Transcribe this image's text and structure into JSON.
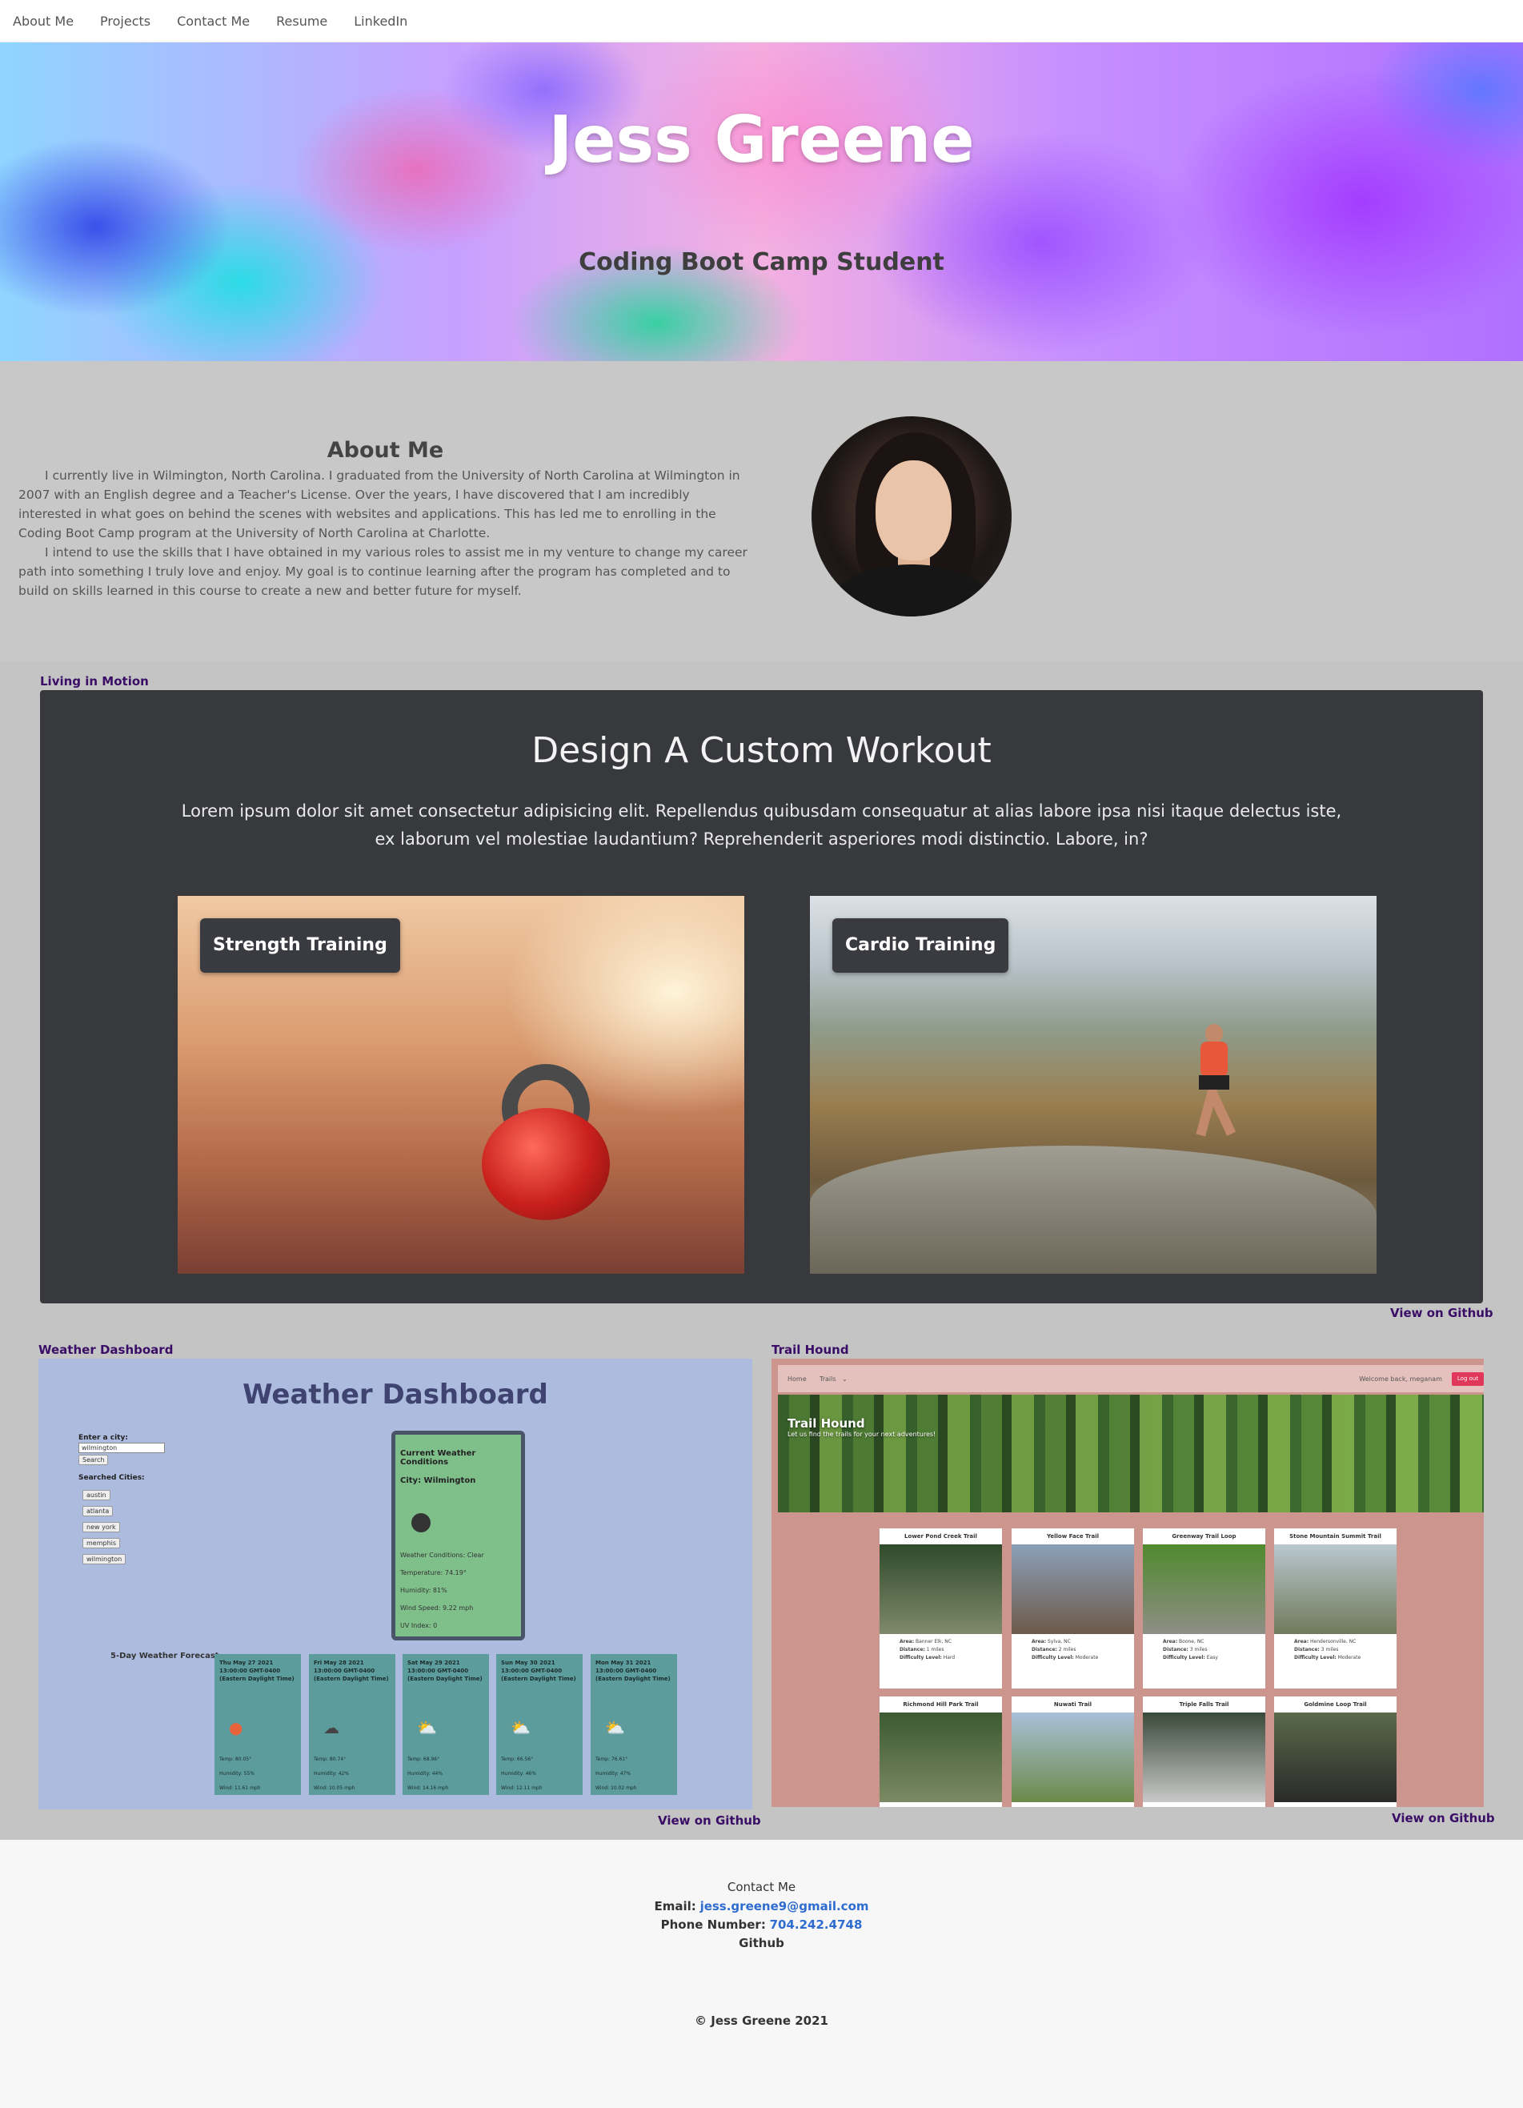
{
  "nav": {
    "items": [
      "About Me",
      "Projects",
      "Contact Me",
      "Resume",
      "LinkedIn"
    ]
  },
  "hero": {
    "title": "Jess Greene",
    "subtitle": "Coding Boot Camp Student"
  },
  "about": {
    "heading": "About Me",
    "paragraphs": [
      "I currently live in Wilmington, North Carolina. I graduated from the University of North Carolina at Wilmington in 2007 with an English degree and a Teacher's License. Over the years, I have discovered that I am incredibly interested in what goes on behind the scenes with websites and applications. This has led me to enrolling in the Coding Boot Camp program at the University of North Carolina at Charlotte.",
      "I intend to use the skills that I have obtained in my various roles to assist me in my venture to change my career path into something I truly love and enjoy. My goal is to continue learning after the program has completed and to build on skills learned in this course to create a new and better future for myself."
    ]
  },
  "projects": {
    "workout": {
      "label": "Living in Motion",
      "title": "Design A Custom Workout",
      "description": "Lorem ipsum dolor sit amet consectetur adipisicing elit. Repellendus quibusdam consequatur at alias labore ipsa nisi itaque delectus iste, ex laborum vel molestiae laudantium? Reprehenderit asperiores modi distinctio. Labore, in?",
      "cards": [
        "Strength Training",
        "Cardio Training"
      ],
      "github": "View on Github"
    },
    "weather": {
      "label": "Weather Dashboard",
      "title": "Weather Dashboard",
      "enter_city": "Enter a city:",
      "input_value": "wilmington",
      "search_button": "Search",
      "searched_label": "Searched Cities:",
      "cities": [
        "austin",
        "atlanta",
        "new york",
        "memphis",
        "wilmington"
      ],
      "current_title": "Current Weather Conditions",
      "current_city": "City: Wilmington",
      "current_values": [
        "Weather Conditions: Clear",
        "Temperature: 74.19°",
        "Humidity: 81%",
        "Wind Speed: 9.22 mph",
        "UV Index: 0"
      ],
      "forecast_label": "5-Day Weather Forecast",
      "forecast": [
        {
          "date": "Thu May 27 2021 13:00:00 GMT-0400 (Eastern Daylight Time)",
          "icon": "sun-icon",
          "glyph": "●",
          "color": "#e8633a",
          "temp": "Temp: 80.05°",
          "humidity": "Humidity: 55%",
          "wind": "Wind: 11.61 mph"
        },
        {
          "date": "Fri May 28 2021 13:00:00 GMT-0400 (Eastern Daylight Time)",
          "icon": "cloud-icon",
          "glyph": "☁",
          "color": "#444444",
          "temp": "Temp: 80.74°",
          "humidity": "Humidity: 42%",
          "wind": "Wind: 10.05 mph"
        },
        {
          "date": "Sat May 29 2021 13:00:00 GMT-0400 (Eastern Daylight Time)",
          "icon": "partly-cloudy-icon",
          "glyph": "⛅",
          "color": "#f0f0f0",
          "temp": "Temp: 68.96°",
          "humidity": "Humidity: 44%",
          "wind": "Wind: 14.16 mph"
        },
        {
          "date": "Sun May 30 2021 13:00:00 GMT-0400 (Eastern Daylight Time)",
          "icon": "partly-cloudy-icon",
          "glyph": "⛅",
          "color": "#f0f0f0",
          "temp": "Temp: 66.56°",
          "humidity": "Humidity: 46%",
          "wind": "Wind: 12.11 mph"
        },
        {
          "date": "Mon May 31 2021 13:00:00 GMT-0400 (Eastern Daylight Time)",
          "icon": "partly-cloudy-icon",
          "glyph": "⛅",
          "color": "#f0f0f0",
          "temp": "Temp: 76.61°",
          "humidity": "Humidity: 47%",
          "wind": "Wind: 10.02 mph"
        }
      ],
      "github": "View on Github"
    },
    "trail": {
      "label": "Trail Hound",
      "nav_home": "Home",
      "nav_trails": "Trails",
      "welcome": "Welcome back, meganam",
      "logout": "Log out",
      "hero_title": "Trail Hound",
      "hero_subtitle": "Let us find the trails for your next adventures!",
      "cards": [
        {
          "title": "Lower Pond Creek Trail",
          "area": "Banner Elk, NC",
          "distance": "1 miles",
          "difficulty": "Hard",
          "c1": "#2f4a2a",
          "c2": "#7f8a6c"
        },
        {
          "title": "Yellow Face Trail",
          "area": "Sylva, NC",
          "distance": "2 miles",
          "difficulty": "Moderate",
          "c1": "#8aa0b8",
          "c2": "#6e5a4a"
        },
        {
          "title": "Greenway Trail Loop",
          "area": "Boone, NC",
          "distance": "3 miles",
          "difficulty": "Easy",
          "c1": "#4f8a2e",
          "c2": "#8e8e86"
        },
        {
          "title": "Stone Mountain Summit Trail",
          "area": "Hendersonville, NC",
          "distance": "3 miles",
          "difficulty": "Moderate",
          "c1": "#b9c8cf",
          "c2": "#6f7a5a"
        },
        {
          "title": "Richmond Hill Park Trail",
          "area": "",
          "distance": "",
          "difficulty": "",
          "c1": "#3c5a33",
          "c2": "#7b8a62"
        },
        {
          "title": "Nuwati Trail",
          "area": "",
          "distance": "",
          "difficulty": "",
          "c1": "#a8c0d8",
          "c2": "#6b8a4a"
        },
        {
          "title": "Triple Falls Trail",
          "area": "",
          "distance": "",
          "difficulty": "",
          "c1": "#3a4a3a",
          "c2": "#c8c8c8"
        },
        {
          "title": "Goldmine Loop Trail",
          "area": "",
          "distance": "",
          "difficulty": "",
          "c1": "#5a6a4a",
          "c2": "#2a2a2a"
        }
      ],
      "area_label": "Area:",
      "distance_label": "Distance:",
      "difficulty_label": "Difficulty Level:",
      "github": "View on Github"
    }
  },
  "footer": {
    "contact_title": "Contact Me",
    "email_label": "Email:",
    "email": "jess.greene9@gmail.com",
    "phone_label": "Phone Number:",
    "phone": "704.242.4748",
    "github": "Github",
    "copyright": "© Jess Greene 2021"
  }
}
